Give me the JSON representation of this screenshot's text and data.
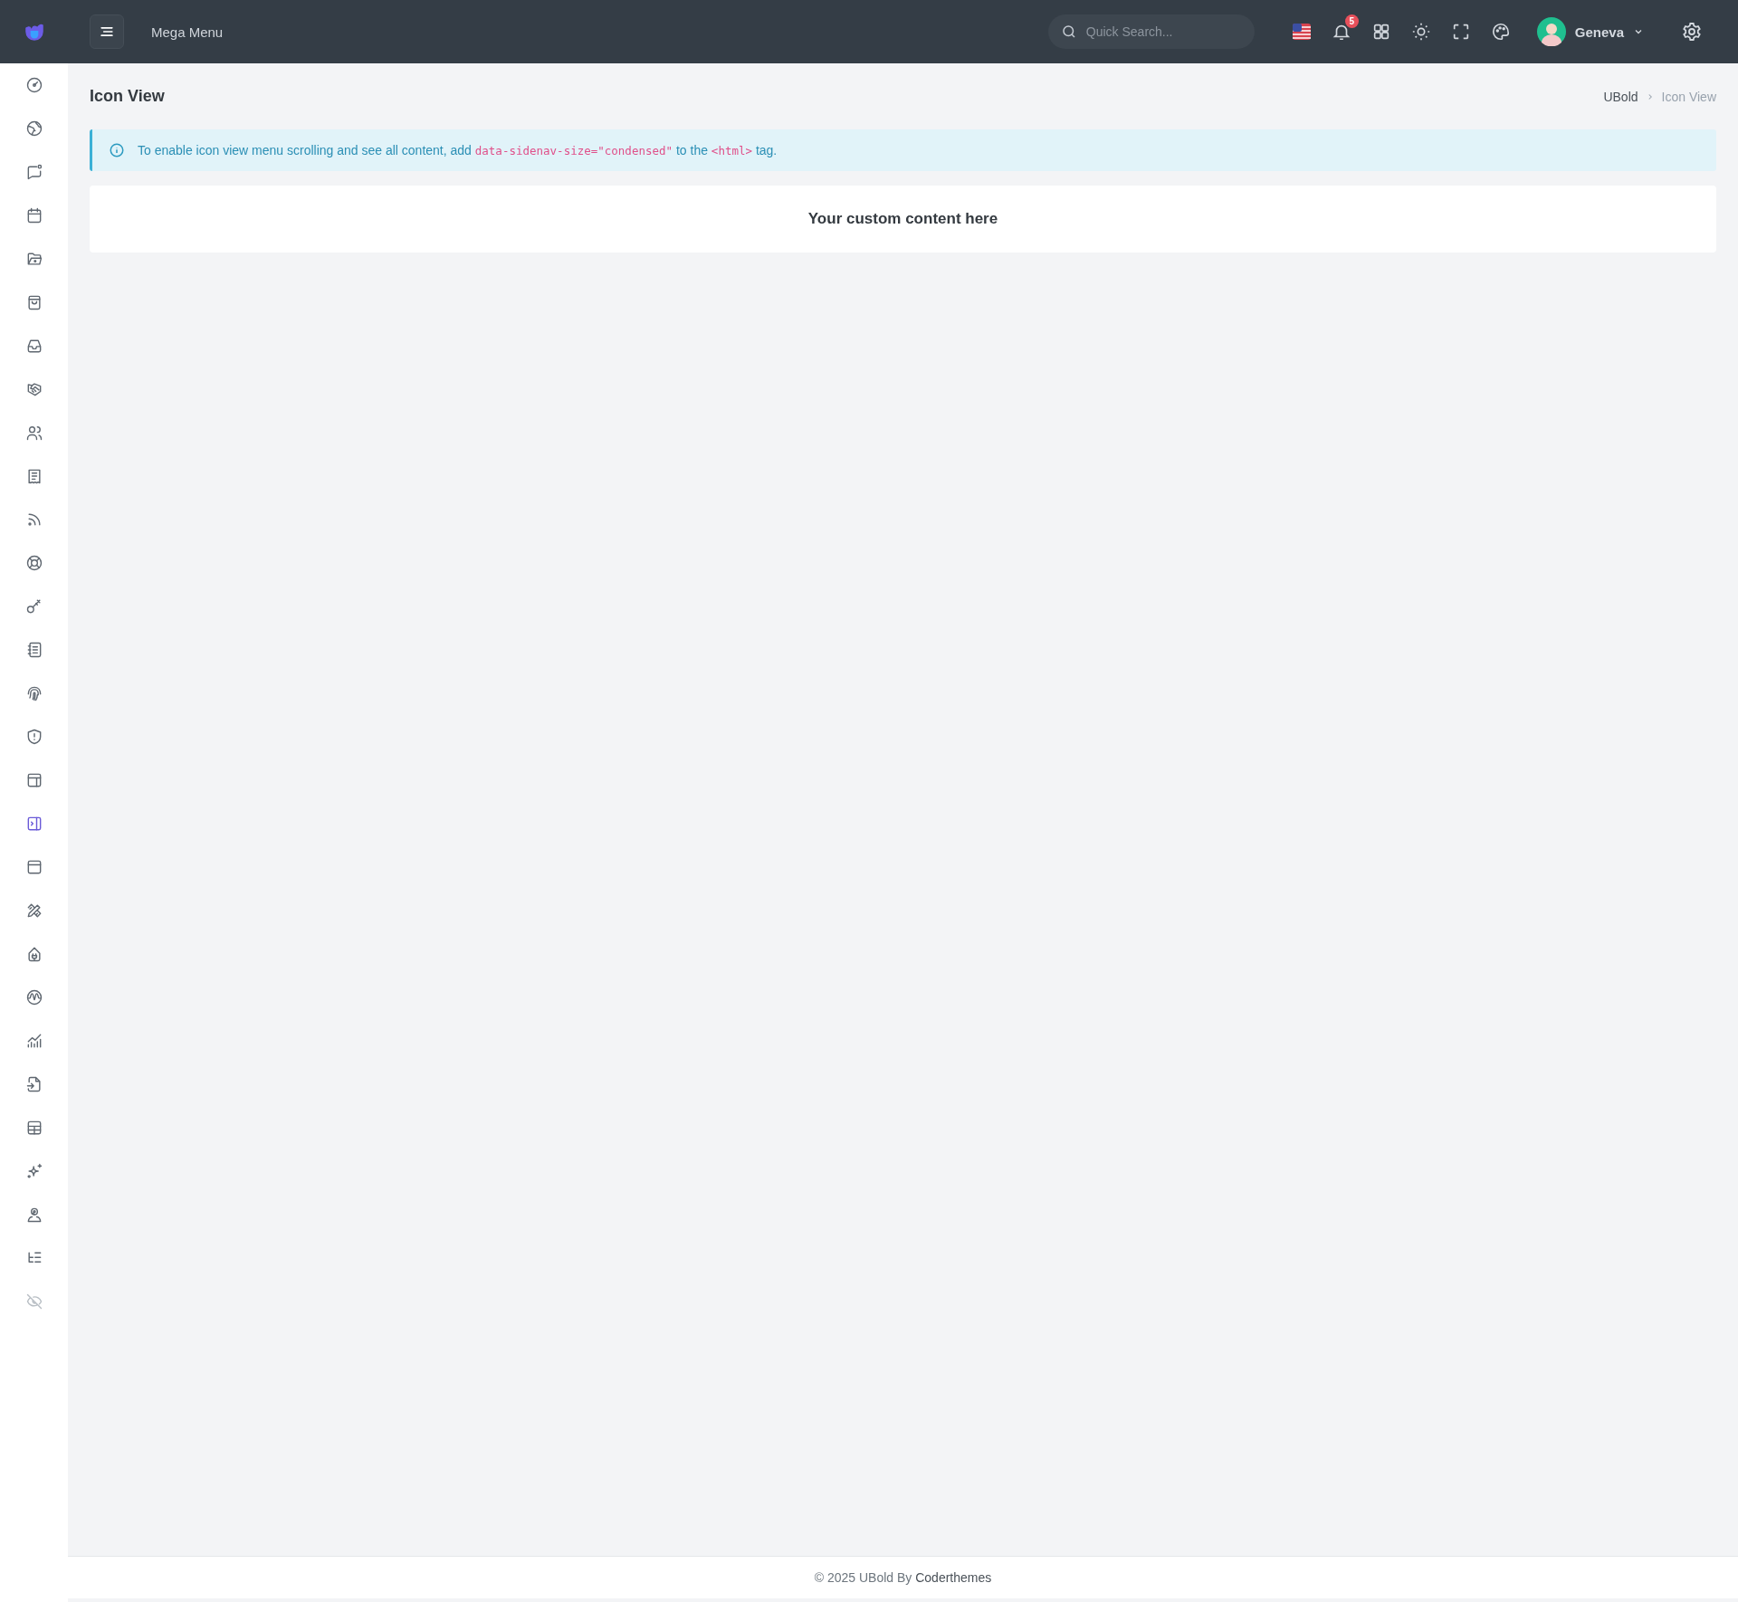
{
  "topbar": {
    "mega_menu": "Mega Menu",
    "search": {
      "placeholder": "Quick Search..."
    },
    "notifications": {
      "count": "5"
    },
    "user": {
      "name": "Geneva"
    }
  },
  "sidebar": {
    "items": [
      {
        "selected": false,
        "disabled": false
      },
      {
        "selected": false,
        "disabled": false
      },
      {
        "selected": false,
        "disabled": false
      },
      {
        "selected": false,
        "disabled": false
      },
      {
        "selected": false,
        "disabled": false
      },
      {
        "selected": false,
        "disabled": false
      },
      {
        "selected": false,
        "disabled": false
      },
      {
        "selected": false,
        "disabled": false
      },
      {
        "selected": false,
        "disabled": false
      },
      {
        "selected": false,
        "disabled": false
      },
      {
        "selected": false,
        "disabled": false
      },
      {
        "selected": false,
        "disabled": false
      },
      {
        "selected": false,
        "disabled": false
      },
      {
        "selected": false,
        "disabled": false
      },
      {
        "selected": false,
        "disabled": false
      },
      {
        "selected": false,
        "disabled": false
      },
      {
        "selected": false,
        "disabled": false
      },
      {
        "selected": true,
        "disabled": false
      },
      {
        "selected": false,
        "disabled": false
      },
      {
        "selected": false,
        "disabled": false
      },
      {
        "selected": false,
        "disabled": false
      },
      {
        "selected": false,
        "disabled": false
      },
      {
        "selected": false,
        "disabled": false
      },
      {
        "selected": false,
        "disabled": false
      },
      {
        "selected": false,
        "disabled": false
      },
      {
        "selected": false,
        "disabled": false
      },
      {
        "selected": false,
        "disabled": false
      },
      {
        "selected": false,
        "disabled": false
      },
      {
        "selected": false,
        "disabled": true
      }
    ]
  },
  "page": {
    "title": "Icon View",
    "breadcrumb": [
      {
        "label": "UBold",
        "current": false
      },
      {
        "label": "Icon View",
        "current": true
      }
    ]
  },
  "alert": {
    "parts": [
      {
        "kind": "text",
        "text": "To enable icon view menu scrolling and see all content, add "
      },
      {
        "kind": "code",
        "text": "data-sidenav-size=\"condensed\""
      },
      {
        "kind": "text",
        "text": " to the "
      },
      {
        "kind": "code",
        "text": "<html>"
      },
      {
        "kind": "text",
        "text": " tag."
      }
    ]
  },
  "card": {
    "text": "Your custom content here"
  },
  "footer": {
    "text": "© 2025 UBold By **Coderthemes**"
  }
}
